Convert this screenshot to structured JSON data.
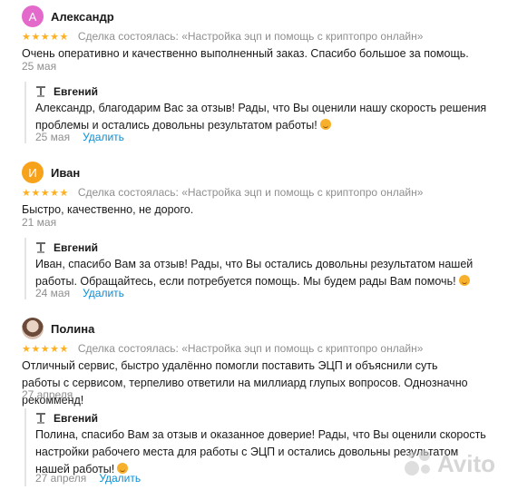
{
  "reviews": [
    {
      "avatar_letter": "А",
      "avatar_color": "#e36acb",
      "author": "Александр",
      "stars": "★★★★★",
      "rating": 5,
      "deal": "Сделка состоялась: «Настройка эцп и помощь с криптопро онлайн»",
      "text": "Очень оперативно и качественно выполненный заказ. Спасибо большое за помощь.",
      "date": "25 мая",
      "reply": {
        "author": "Евгений",
        "text": "Александр, благодарим Вас за отзыв! Рады, что Вы оценили нашу скорость решения проблемы и остались довольны результатом работы!",
        "date": "25 мая",
        "delete_label": "Удалить"
      }
    },
    {
      "avatar_letter": "И",
      "avatar_color": "#f7a21b",
      "author": "Иван",
      "stars": "★★★★★",
      "rating": 5,
      "deal": "Сделка состоялась: «Настройка эцп и помощь с криптопро онлайн»",
      "text": "Быстро, качественно, не дорого.",
      "date": "21 мая",
      "reply": {
        "author": "Евгений",
        "text": "Иван, спасибо Вам за отзыв! Рады, что Вы остались довольны результатом нашей работы. Обращайтесь, если потребуется помощь. Мы будем рады Вам помочь!",
        "date": "24 мая",
        "delete_label": "Удалить"
      }
    },
    {
      "author": "Полина",
      "stars": "★★★★★",
      "rating": 5,
      "deal": "Сделка состоялась: «Настройка эцп и помощь с криптопро онлайн»",
      "text": "Отличный сервис, быстро удалённо помогли поставить ЭЦП и объяснили суть работы с сервисом, терпеливо ответили на миллиард глупых вопросов. Однозначно рекомменд!",
      "date": "27 апреля",
      "reply": {
        "author": "Евгений",
        "text": "Полина, спасибо Вам за отзыв и оказанное доверие! Рады, что Вы оценили скорость настройки рабочего места для работы с ЭЦП и остались довольны результатом нашей работы!",
        "date": "27 апреля",
        "delete_label": "Удалить"
      }
    }
  ],
  "watermark": "Avito",
  "colors": {
    "star": "#ffb021",
    "link": "#0a8fd6",
    "muted": "#8f8f8f"
  }
}
